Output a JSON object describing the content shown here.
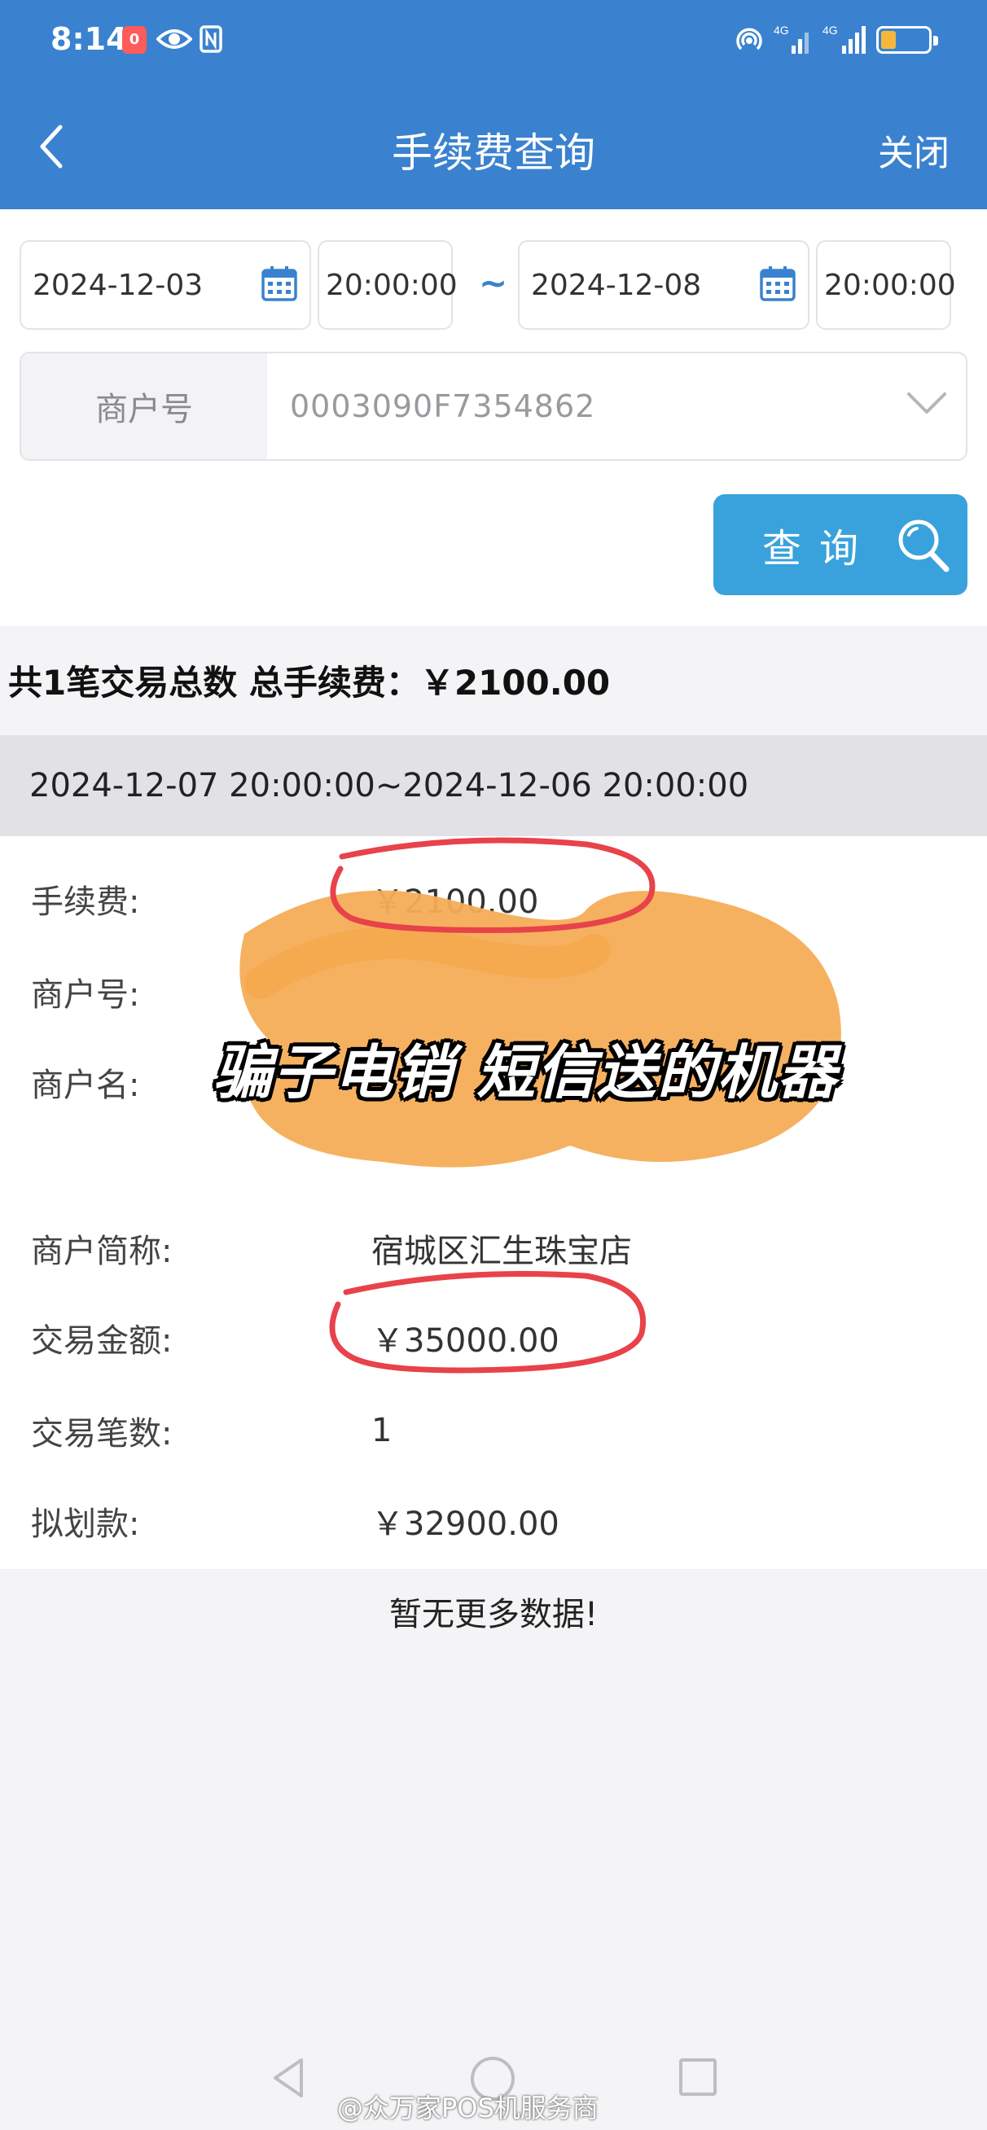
{
  "status_bar": {
    "time": "8:14",
    "notif_badge": "0"
  },
  "header": {
    "title": "手续费查询",
    "close_label": "关闭"
  },
  "filter": {
    "start_date": "2024-12-03",
    "start_time": "20:00:00",
    "separator": "~",
    "end_date": "2024-12-08",
    "end_time": "20:00:00",
    "merchant_label": "商户号",
    "merchant_value": "0003090F7354862",
    "query_label": "查询"
  },
  "summary": {
    "text": "共1笔交易总数 总手续费：￥2100.00"
  },
  "record": {
    "period": "2024-12-07 20:00:00~2024-12-06 20:00:00",
    "fields": [
      {
        "label": "手续费:",
        "value": "￥2100.00"
      },
      {
        "label": "商户号:",
        "value": ""
      },
      {
        "label": "商户名:",
        "value": ""
      },
      {
        "label": "商户简称:",
        "value": "宿城区汇生珠宝店"
      },
      {
        "label": "交易金额:",
        "value": "￥35000.00"
      },
      {
        "label": "交易笔数:",
        "value": "1"
      },
      {
        "label": "拟划款:",
        "value": "￥32900.00"
      }
    ]
  },
  "overlay_caption": "骗子电销 短信送的机器",
  "list_footer": "暂无更多数据!",
  "watermark": "@众万家POS机服务商",
  "colors": {
    "header_bg": "#3a82cf",
    "button_bg": "#39a2dc",
    "highlight_circle": "#e8424a",
    "blur_patch": "#f6ad57"
  }
}
